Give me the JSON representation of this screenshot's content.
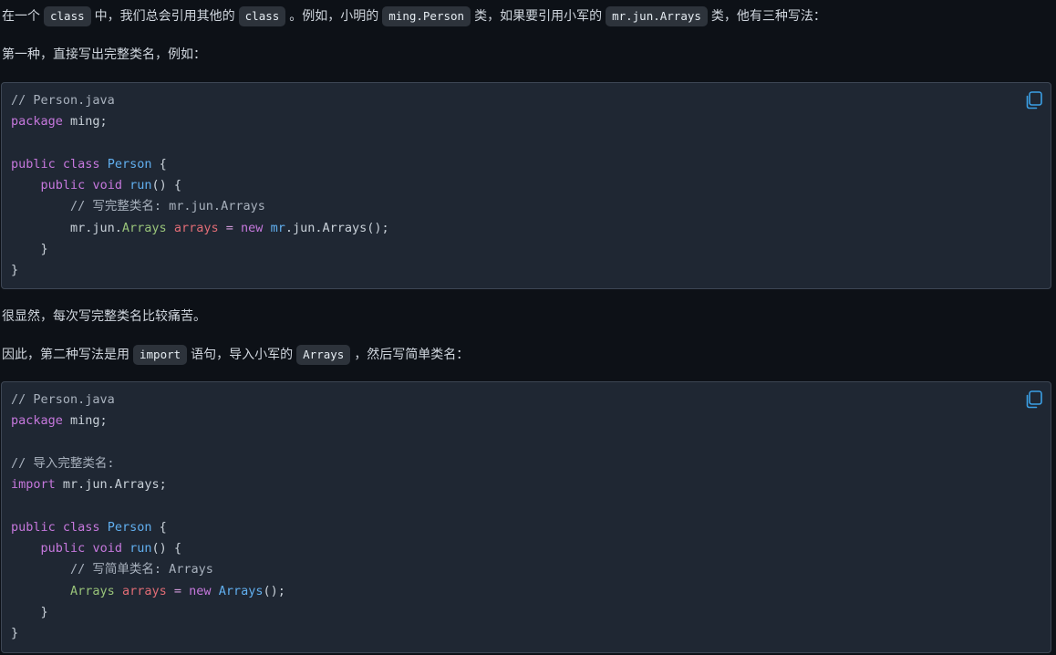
{
  "paragraphs": {
    "p1": {
      "t1": "在一个",
      "c1": "class",
      "t2": "中，我们总会引用其他的",
      "c2": "class",
      "t3": "。例如，小明的",
      "c3": "ming.Person",
      "t4": "类，如果要引用小军的",
      "c4": "mr.jun.Arrays",
      "t5": "类，他有三种写法："
    },
    "p2": "第一种，直接写出完整类名，例如：",
    "p3": "很显然，每次写完整类名比较痛苦。",
    "p4": {
      "t1": "因此，第二种写法是用",
      "c1": "import",
      "t2": "语句，导入小军的",
      "c2": "Arrays",
      "t3": "，然后写简单类名："
    }
  },
  "code_blocks": [
    {
      "lines": [
        [
          {
            "t": "// Person.java",
            "k": "comment"
          }
        ],
        [
          {
            "t": "package",
            "k": "keyword"
          },
          {
            "t": " ming;",
            "k": "plain"
          }
        ],
        [],
        [
          {
            "t": "public",
            "k": "keyword"
          },
          {
            "t": " ",
            "k": "plain"
          },
          {
            "t": "class",
            "k": "keyword"
          },
          {
            "t": " ",
            "k": "plain"
          },
          {
            "t": "Person",
            "k": "type"
          },
          {
            "t": " {",
            "k": "plain"
          }
        ],
        [
          {
            "t": "    ",
            "k": "plain"
          },
          {
            "t": "public",
            "k": "keyword"
          },
          {
            "t": " ",
            "k": "plain"
          },
          {
            "t": "void",
            "k": "keyword"
          },
          {
            "t": " ",
            "k": "plain"
          },
          {
            "t": "run",
            "k": "type"
          },
          {
            "t": "() {",
            "k": "plain"
          }
        ],
        [
          {
            "t": "        ",
            "k": "plain"
          },
          {
            "t": "// 写完整类名: mr.jun.Arrays",
            "k": "comment"
          }
        ],
        [
          {
            "t": "        mr.jun.",
            "k": "plain"
          },
          {
            "t": "Arrays",
            "k": "class"
          },
          {
            "t": " ",
            "k": "plain"
          },
          {
            "t": "arrays",
            "k": "var"
          },
          {
            "t": " ",
            "k": "plain"
          },
          {
            "t": "=",
            "k": "op"
          },
          {
            "t": " ",
            "k": "plain"
          },
          {
            "t": "new",
            "k": "keyword"
          },
          {
            "t": " ",
            "k": "plain"
          },
          {
            "t": "mr",
            "k": "type"
          },
          {
            "t": ".jun.Arrays();",
            "k": "plain"
          }
        ],
        [
          {
            "t": "    }",
            "k": "plain"
          }
        ],
        [
          {
            "t": "}",
            "k": "plain"
          }
        ]
      ]
    },
    {
      "lines": [
        [
          {
            "t": "// Person.java",
            "k": "comment"
          }
        ],
        [
          {
            "t": "package",
            "k": "keyword"
          },
          {
            "t": " ming;",
            "k": "plain"
          }
        ],
        [],
        [
          {
            "t": "// 导入完整类名:",
            "k": "comment"
          }
        ],
        [
          {
            "t": "import",
            "k": "keyword"
          },
          {
            "t": " mr.jun.Arrays;",
            "k": "plain"
          }
        ],
        [],
        [
          {
            "t": "public",
            "k": "keyword"
          },
          {
            "t": " ",
            "k": "plain"
          },
          {
            "t": "class",
            "k": "keyword"
          },
          {
            "t": " ",
            "k": "plain"
          },
          {
            "t": "Person",
            "k": "type"
          },
          {
            "t": " {",
            "k": "plain"
          }
        ],
        [
          {
            "t": "    ",
            "k": "plain"
          },
          {
            "t": "public",
            "k": "keyword"
          },
          {
            "t": " ",
            "k": "plain"
          },
          {
            "t": "void",
            "k": "keyword"
          },
          {
            "t": " ",
            "k": "plain"
          },
          {
            "t": "run",
            "k": "type"
          },
          {
            "t": "() {",
            "k": "plain"
          }
        ],
        [
          {
            "t": "        ",
            "k": "plain"
          },
          {
            "t": "// 写简单类名: Arrays",
            "k": "comment"
          }
        ],
        [
          {
            "t": "        ",
            "k": "plain"
          },
          {
            "t": "Arrays",
            "k": "class"
          },
          {
            "t": " ",
            "k": "plain"
          },
          {
            "t": "arrays",
            "k": "var"
          },
          {
            "t": " ",
            "k": "plain"
          },
          {
            "t": "=",
            "k": "op"
          },
          {
            "t": " ",
            "k": "plain"
          },
          {
            "t": "new",
            "k": "keyword"
          },
          {
            "t": " ",
            "k": "plain"
          },
          {
            "t": "Arrays",
            "k": "type"
          },
          {
            "t": "();",
            "k": "plain"
          }
        ],
        [
          {
            "t": "    }",
            "k": "plain"
          }
        ],
        [
          {
            "t": "}",
            "k": "plain"
          }
        ]
      ]
    }
  ],
  "icons": {
    "copy": "copy-icon"
  },
  "colors": {
    "background": "#0d1117",
    "code_bg": "#1f2733",
    "code_border": "#3d4654",
    "inline_code_bg": "#2d333b",
    "keyword": "#c678dd",
    "type": "#61afef",
    "class": "#98c379",
    "variable": "#e06c75",
    "comment": "#a8b1bd",
    "copy_icon": "#3ba0e6"
  }
}
